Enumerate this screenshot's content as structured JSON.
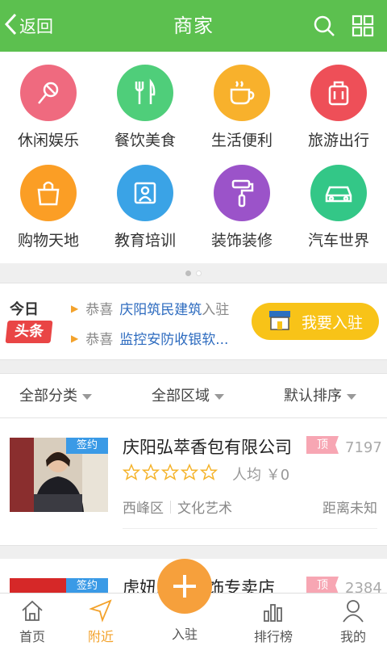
{
  "header": {
    "back_label": "返回",
    "title": "商家",
    "background_color": "#5cc04f"
  },
  "categories": [
    {
      "label": "休闲娱乐",
      "icon": "microphone-icon",
      "color": "#ef6a7f"
    },
    {
      "label": "餐饮美食",
      "icon": "fork-knife-icon",
      "color": "#4fce7a"
    },
    {
      "label": "生活便利",
      "icon": "coffee-cup-icon",
      "color": "#f8b12c"
    },
    {
      "label": "旅游出行",
      "icon": "suitcase-icon",
      "color": "#ee4f58"
    },
    {
      "label": "购物天地",
      "icon": "shopping-bag-icon",
      "color": "#fb9e25"
    },
    {
      "label": "教育培训",
      "icon": "education-icon",
      "color": "#3aa3e6"
    },
    {
      "label": "装饰装修",
      "icon": "paint-roller-icon",
      "color": "#9b53c9"
    },
    {
      "label": "汽车世界",
      "icon": "car-icon",
      "color": "#33c787"
    }
  ],
  "headline": {
    "today": "今日",
    "tag": "头条",
    "items": [
      {
        "prefix": "恭喜",
        "name": "庆阳筑民建筑",
        "suffix": "入驻"
      },
      {
        "prefix": "恭喜",
        "name": "监控安防收银软...",
        "suffix": ""
      }
    ],
    "join_label": "我要入驻"
  },
  "filters": {
    "category": "全部分类",
    "region": "全部区域",
    "sort": "默认排序"
  },
  "listings": [
    {
      "signed": "签约",
      "name": "庆阳弘萃香包有限公司",
      "badge": "顶",
      "views": "7197",
      "rating": 0,
      "avg_price": "人均 ￥0",
      "district": "西峰区",
      "category": "文化艺术",
      "distance": "距离未知"
    },
    {
      "signed": "签约",
      "name": "虎妞庆阳服饰专卖店",
      "badge": "顶",
      "views": "2384"
    }
  ],
  "bottom_nav": {
    "home": "首页",
    "nearby": "附近",
    "join": "入驻",
    "ranking": "排行榜",
    "mine": "我的"
  }
}
